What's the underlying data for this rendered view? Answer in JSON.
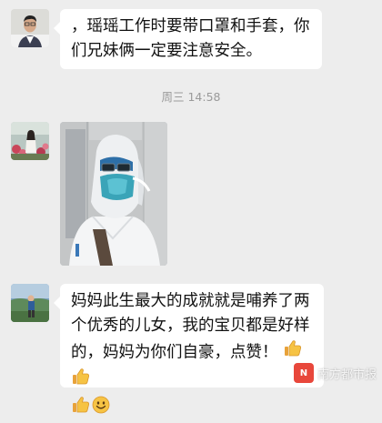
{
  "messages": [
    {
      "type": "text",
      "sender": "father",
      "lines": [
        "，瑶瑶工作时要带口罩和手套，你",
        "们兄妹俩一定要注意安全。"
      ]
    },
    {
      "type": "timestamp",
      "text": "周三 14:58"
    },
    {
      "type": "image",
      "sender": "daughter"
    },
    {
      "type": "text",
      "sender": "mother",
      "lines": [
        "妈妈此生最大的成就就是哺养了两",
        "个优秀的儿女，我的宝贝都是好样",
        "的，妈妈为你们自豪，点赞！"
      ]
    }
  ],
  "emojis": [
    "thumbs-up-icon",
    "thumbs-up-icon",
    "thumbs-up-icon",
    "smile-icon"
  ],
  "watermark": {
    "logo": "N",
    "text": "南方都市报"
  },
  "colors": {
    "background": "#ededed",
    "bubble": "#ffffff",
    "timestamp": "#9a9a9a",
    "brand": "#e8473b"
  }
}
